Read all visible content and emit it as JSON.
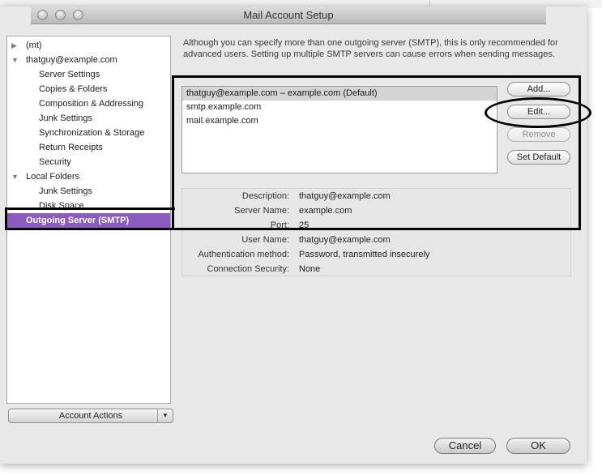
{
  "window": {
    "title": "Mail Account Setup"
  },
  "sidebar": {
    "items": [
      {
        "label": "(mt)",
        "indent": 0,
        "expander": "collapsed"
      },
      {
        "label": "thatguy@example.com",
        "indent": 0,
        "expander": "expanded"
      },
      {
        "label": "Server Settings",
        "indent": 1
      },
      {
        "label": "Copies & Folders",
        "indent": 1
      },
      {
        "label": "Composition & Addressing",
        "indent": 1
      },
      {
        "label": "Junk Settings",
        "indent": 1
      },
      {
        "label": "Synchronization & Storage",
        "indent": 1
      },
      {
        "label": "Return Receipts",
        "indent": 1
      },
      {
        "label": "Security",
        "indent": 1
      },
      {
        "label": "Local Folders",
        "indent": 0,
        "expander": "expanded"
      },
      {
        "label": "Junk Settings",
        "indent": 1
      },
      {
        "label": "Disk Space",
        "indent": 1
      },
      {
        "label": "Outgoing Server (SMTP)",
        "indent": 0,
        "selected": true
      }
    ]
  },
  "account_actions": {
    "label": "Account Actions"
  },
  "main": {
    "description": "Although you can specify more than one outgoing server (SMTP), this is only recommended for advanced users. Setting up multiple SMTP servers can cause errors when sending messages.",
    "servers": [
      {
        "label": "thatguy@example.com – example.com (Default)",
        "selected": true
      },
      {
        "label": "smtp.example.com"
      },
      {
        "label": "mail.example.com"
      }
    ],
    "buttons": {
      "add": "Add...",
      "edit": "Edit...",
      "remove": "Remove",
      "set_default": "Set Default"
    },
    "details": [
      {
        "key": "Description:",
        "value": "thatguy@example.com"
      },
      {
        "key": "Server Name:",
        "value": "example.com"
      },
      {
        "key": "Port:",
        "value": "25"
      },
      {
        "key": "User Name:",
        "value": "thatguy@example.com"
      },
      {
        "key": "Authentication method:",
        "value": "Password, transmitted insecurely"
      },
      {
        "key": "Connection Security:",
        "value": "None"
      }
    ]
  },
  "footer": {
    "cancel": "Cancel",
    "ok": "OK"
  },
  "colors": {
    "selection": "#8b5bbf",
    "window_bg": "#e8e8e8",
    "highlight_stroke": "#000000"
  },
  "icons": {
    "expand": "disclosure-triangle-icon",
    "dropdown": "chevron-down-icon"
  }
}
